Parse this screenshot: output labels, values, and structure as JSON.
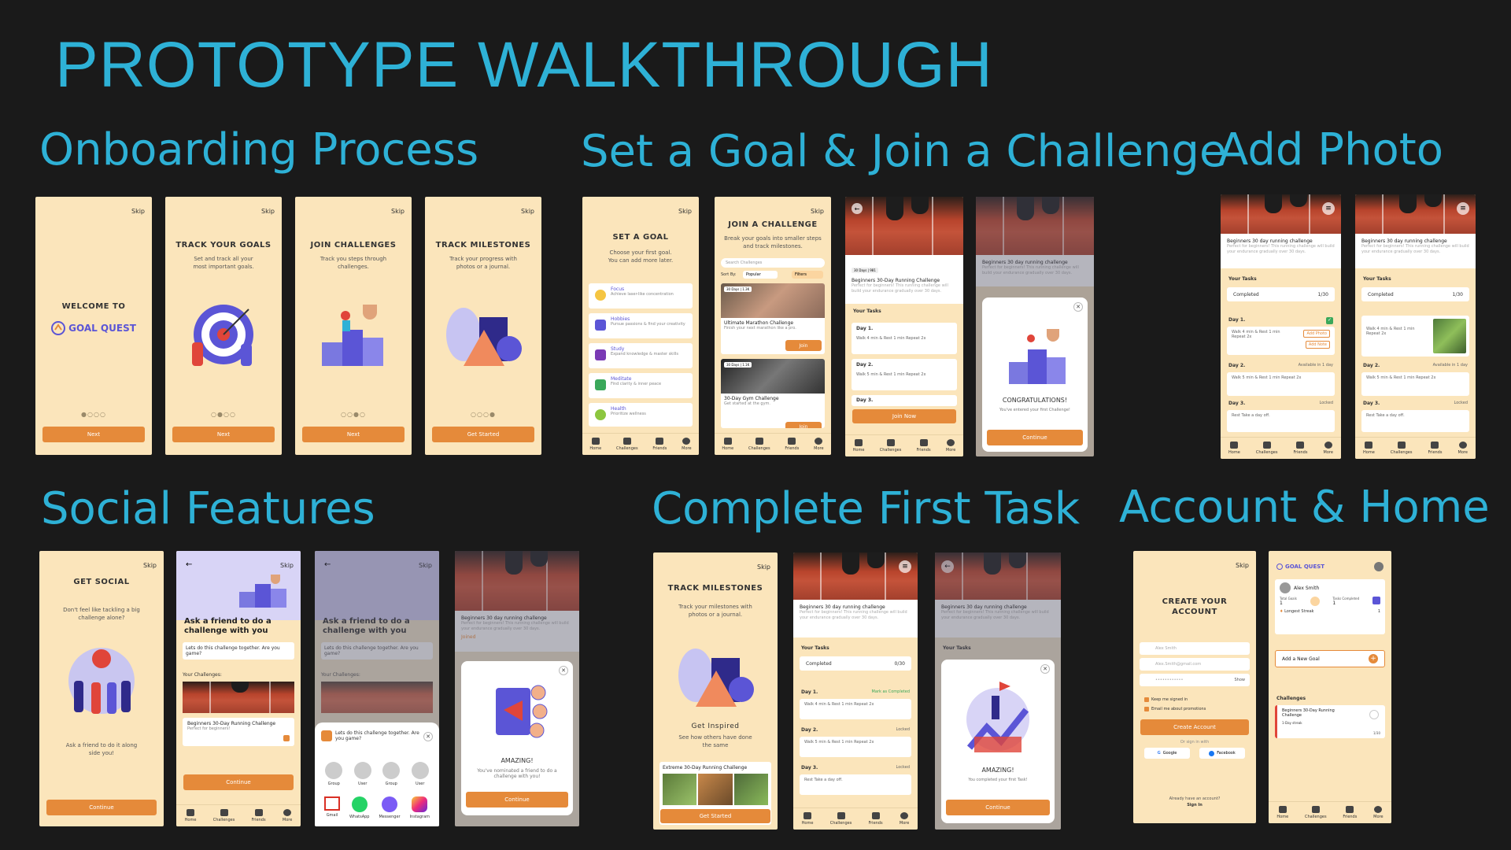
{
  "main_title": "PROTOTYPE WALKTHROUGH",
  "sections": {
    "onboarding": "Onboarding Process",
    "goal": "Set a Goal & Join a Challenge",
    "photo": "Add Photo",
    "social": "Social Features",
    "first_task": "Complete First Task",
    "account": "Account & Home"
  },
  "common": {
    "skip": "Skip",
    "next": "Next",
    "continue": "Continue",
    "get_started": "Get Started",
    "join": "Join",
    "join_now": "Join Now",
    "nav": [
      "Home",
      "Challenges",
      "Friends",
      "More"
    ]
  },
  "onboarding": {
    "welcome_to": "WELCOME TO",
    "brand": "GOAL QUEST",
    "track_goals_title": "TRACK YOUR GOALS",
    "track_goals_sub": "Set and track all your most important goals.",
    "join_challenges_title": "JOIN CHALLENGES",
    "join_challenges_sub": "Track you steps through challenges.",
    "track_milestones_title": "TRACK MILESTONES",
    "track_milestones_sub": "Track your progress with photos or a journal."
  },
  "goal": {
    "set_goal_title": "SET A GOAL",
    "set_goal_sub": "Choose your first goal. You can add more later.",
    "goals": [
      {
        "name": "Focus",
        "desc": "Achieve laser-like concentration"
      },
      {
        "name": "Hobbies",
        "desc": "Pursue passions & find your creativity"
      },
      {
        "name": "Study",
        "desc": "Expand knowledge & master skills"
      },
      {
        "name": "Meditate",
        "desc": "Find clarity & inner peace"
      },
      {
        "name": "Health",
        "desc": "Prioritize wellness"
      }
    ],
    "join_title": "JOIN A CHALLENGE",
    "join_sub": "Break your goals into smaller steps and track milestones.",
    "search_placeholder": "Search Challenges",
    "sort_by": "Sort By:",
    "sort_value": "Popular",
    "filter_value": "Filters",
    "challenge1_title": "Ultimate Marathon Challenge",
    "challenge1_desc": "Finish your next marathon like a pro.",
    "challenge1_badge": "30 Days | 1.3K",
    "challenge2_title": "30-Day Gym Challenge",
    "challenge2_desc": "Get started at the gym.",
    "challenge2_badge": "30 Days | 1.1K",
    "detail_badge": "30 Days | 981",
    "detail_title": "Beginners 30-Day Running Challenge",
    "detail_desc": "Perfect for beginners! This running challenge will build your endurance gradually over 30 days.",
    "your_tasks": "Your Tasks",
    "day1": "Day 1.",
    "day1_task": "Walk 4 min & Rest 1 min Repeat 2x",
    "day2": "Day 2.",
    "day2_task": "Walk 5 min & Rest 1 min Repeat 2x",
    "day3": "Day 3.",
    "congrats_title": "Beginners 30 day running challenge",
    "congrats_desc": "Perfect for beginners! This running challenge will build your endurance gradually over 30 days.",
    "congrats": "CONGRATULATIONS!",
    "congrats_sub": "You've entered your first Challenge!"
  },
  "photo": {
    "title": "Beginners 30 day running challenge",
    "desc": "Perfect for beginners! This running challenge will build your endurance gradually over 30 days.",
    "your_tasks": "Your Tasks",
    "completed": "Completed",
    "progress": "1/30",
    "day1": "Day 1.",
    "day1_task": "Walk 4 min & Rest 1 min Repeat 2x",
    "add_photo": "Add Photo",
    "add_note": "Add Note",
    "day2": "Day 2.",
    "day2_status": "Available in 1 day",
    "day2_task": "Walk 5 min & Rest 1 min Repeat 2x",
    "day3": "Day 3.",
    "day3_status": "Locked",
    "day3_task": "Rest Take a day off."
  },
  "social": {
    "get_social_title": "GET SOCIAL",
    "get_social_sub": "Don't feel like tackling a big challenge alone?",
    "get_social_bottom": "Ask a friend to do it along side you!",
    "ask_title": "Ask a friend to do a challenge with you",
    "ask_sub": "Lets do this challenge together. Are you game?",
    "your_challenges": "Your Challenges:",
    "challenge_name": "Beginners 30-Day Running Challenge",
    "challenge_desc": "Perfect for beginners!",
    "share_msg": "Lets do this challenge together. Are you game?",
    "contacts": [
      "Group",
      "User",
      "Group",
      "User"
    ],
    "apps": [
      "Gmail",
      "WhatsApp",
      "Messenger",
      "Instagram"
    ],
    "joined": "Joined",
    "amazing": "AMAZING!",
    "amazing_sub": "You've nominated a friend to do a challenge with you!"
  },
  "first_task": {
    "milestones_title": "TRACK MILESTONES",
    "milestones_sub": "Track your milestones with photos or a journal.",
    "get_inspired": "Get Inspired",
    "inspired_sub": "See how others have done the same",
    "extreme": "Extreme 30-Day Running Challenge",
    "progress": "0/30",
    "mark_completed": "Mark as Completed",
    "locked": "Locked",
    "day3_task": "Rest Take a day off.",
    "amazing": "AMAZING!",
    "amazing_sub": "You completed your first Task!"
  },
  "account": {
    "create_title": "CREATE YOUR ACCOUNT",
    "name_placeholder": "Alex Smith",
    "email_placeholder": "Alex.Smith@gmail.com",
    "password_placeholder": "••••••••••••",
    "show": "Show",
    "keep_signed": "Keep me signed in",
    "email_promos": "Email me about promotions",
    "create_btn": "Create Account",
    "or_sign": "Or sign in with",
    "google": "Google",
    "facebook": "Facebook",
    "already": "Already have an account?",
    "sign_in": "Sign In",
    "user": "Alex Smith",
    "total_goals": "Total Goals",
    "total_goals_val": "1",
    "tasks_completed": "Tasks Completed",
    "tasks_completed_val": "1",
    "longest_streak": "Longest Streak",
    "streak_val": "1",
    "add_goal": "Add a New Goal",
    "challenges": "Challenges",
    "challenge_name": "Beginners 30-Day Running Challenge",
    "streak_badge": "1-Day streak",
    "challenge_progress": "1/30"
  },
  "colors": {
    "accent": "#2eb1d6",
    "orange": "#e58a3a",
    "cream": "#fbe5bb",
    "bg": "#1a1a1a"
  }
}
